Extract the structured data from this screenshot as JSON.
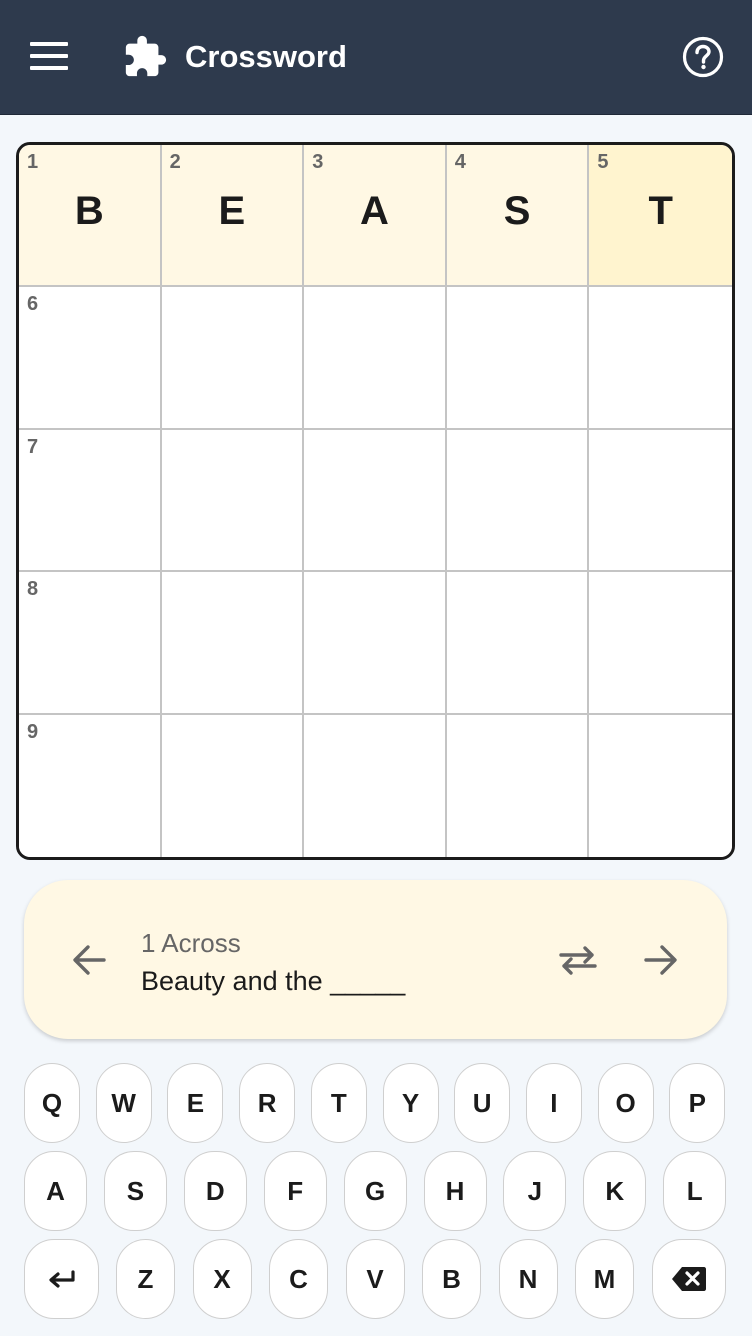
{
  "header": {
    "title": "Crossword",
    "menu_icon": "hamburger-menu-icon",
    "logo_icon": "puzzle-piece-icon",
    "help_icon": "help-circle-icon",
    "background": "#2e3a4d"
  },
  "grid": {
    "rows": [
      [
        {
          "num": "1",
          "letter": "B"
        },
        {
          "num": "2",
          "letter": "E"
        },
        {
          "num": "3",
          "letter": "A"
        },
        {
          "num": "4",
          "letter": "S"
        },
        {
          "num": "5",
          "letter": "T"
        }
      ],
      [
        {
          "num": "6",
          "letter": ""
        },
        {
          "num": "",
          "letter": ""
        },
        {
          "num": "",
          "letter": ""
        },
        {
          "num": "",
          "letter": ""
        },
        {
          "num": "",
          "letter": ""
        }
      ],
      [
        {
          "num": "7",
          "letter": ""
        },
        {
          "num": "",
          "letter": ""
        },
        {
          "num": "",
          "letter": ""
        },
        {
          "num": "",
          "letter": ""
        },
        {
          "num": "",
          "letter": ""
        }
      ],
      [
        {
          "num": "8",
          "letter": ""
        },
        {
          "num": "",
          "letter": ""
        },
        {
          "num": "",
          "letter": ""
        },
        {
          "num": "",
          "letter": ""
        },
        {
          "num": "",
          "letter": ""
        }
      ],
      [
        {
          "num": "9",
          "letter": ""
        },
        {
          "num": "",
          "letter": ""
        },
        {
          "num": "",
          "letter": ""
        },
        {
          "num": "",
          "letter": ""
        },
        {
          "num": "",
          "letter": ""
        }
      ]
    ],
    "highlight_row": 0,
    "active_row": 0,
    "active_col": 4,
    "highlight_color": "#fff8e4",
    "active_color": "#fff4cf"
  },
  "clue": {
    "label": "1 Across",
    "text": "Beauty and the _____",
    "prev_icon": "arrow-left-icon",
    "toggle_icon": "swap-direction-icon",
    "next_icon": "arrow-right-icon"
  },
  "keyboard": {
    "row1": [
      "Q",
      "W",
      "E",
      "R",
      "T",
      "Y",
      "U",
      "I",
      "O",
      "P"
    ],
    "row2": [
      "A",
      "S",
      "D",
      "F",
      "G",
      "H",
      "J",
      "K",
      "L"
    ],
    "row3": [
      "Z",
      "X",
      "C",
      "V",
      "B",
      "N",
      "M"
    ],
    "enter_icon": "enter-icon",
    "backspace_icon": "backspace-icon"
  }
}
